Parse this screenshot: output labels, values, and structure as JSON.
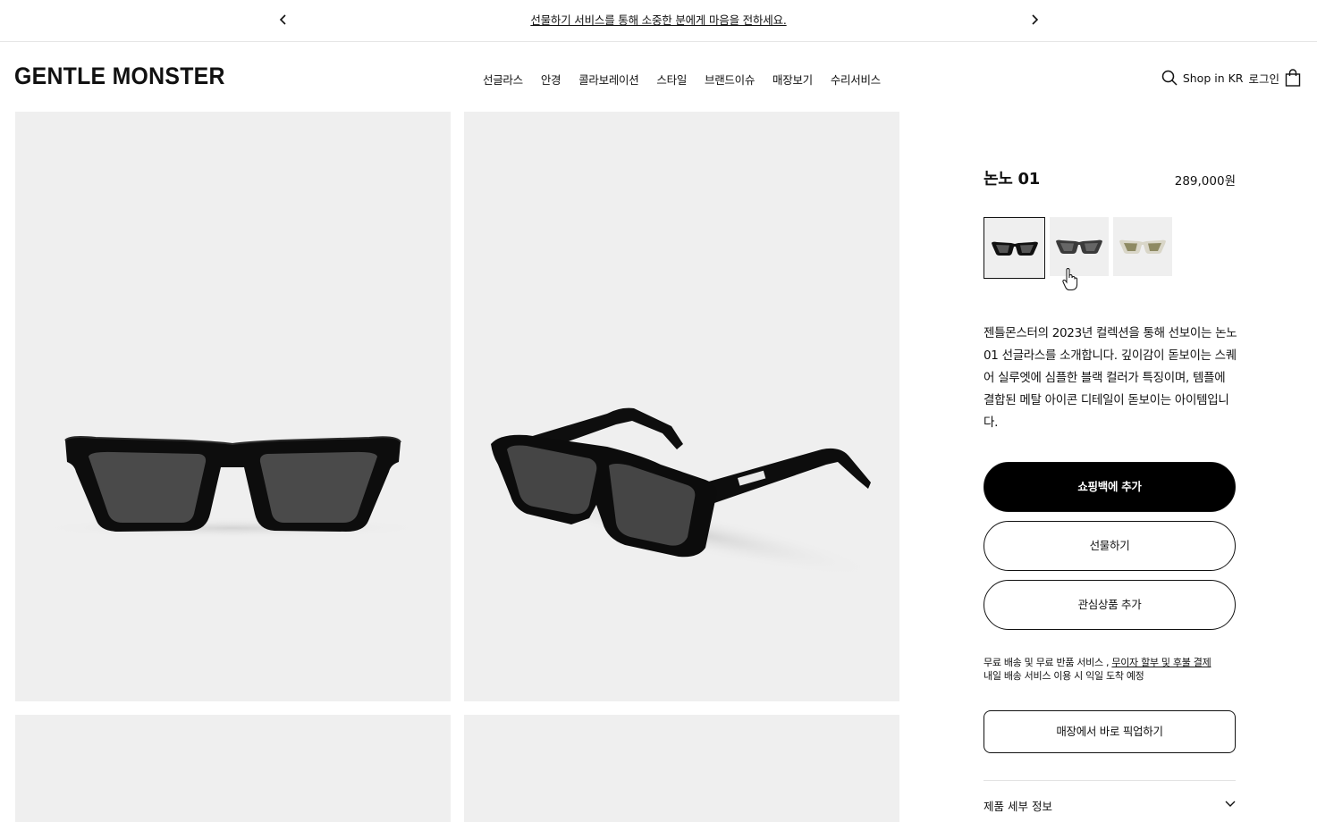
{
  "announcement": {
    "message": "선물하기 서비스를 통해 소중한 분에게 마음을 전하세요.",
    "prev_icon": "chevron-left-icon",
    "next_icon": "chevron-right-icon"
  },
  "header": {
    "logo": "GENTLE MONSTER",
    "nav": [
      "선글라스",
      "안경",
      "콜라보레이션",
      "스타일",
      "브랜드이슈",
      "매장보기",
      "수리서비스"
    ],
    "shop_region": "Shop in KR",
    "login": "로그인",
    "search_icon": "search-icon",
    "bag_icon": "shopping-bag-icon"
  },
  "gallery": {
    "background": "#efefef",
    "images": [
      "front-view-sunglasses",
      "angled-view-sunglasses",
      "detail-image-3",
      "detail-image-4"
    ]
  },
  "product": {
    "name": "논노 01",
    "price": "289,000원",
    "colors": [
      "black",
      "dark-grey",
      "khaki-gold"
    ],
    "selected_color": "black",
    "description": "젠틀몬스터의 2023년 컬렉션을 통해 선보이는 논노 01 선글라스를 소개합니다. 깊이감이 돋보이는 스퀘어 실루엣에 심플한 블랙 컬러가 특징이며, 템플에 결합된 메탈 아이콘 디테일이 돋보이는 아이템입니다.",
    "buttons": {
      "add_to_bag": "쇼핑백에 추가",
      "gift": "선물하기",
      "wishlist": "관심상품 추가",
      "pickup": "매장에서 바로 픽업하기"
    },
    "shipping": {
      "line1_prefix": "무료 배송 및 무료 반품 서비스 , ",
      "line1_link": "무이자 할부 및 후불 결제",
      "line2": "내일 배송 서비스 이용 시 익일 도착 예정"
    },
    "accordion_label": "제품 세부 정보"
  },
  "colors": {
    "primary_button": "#000000",
    "tile_background": "#efefef",
    "text": "#111111"
  }
}
